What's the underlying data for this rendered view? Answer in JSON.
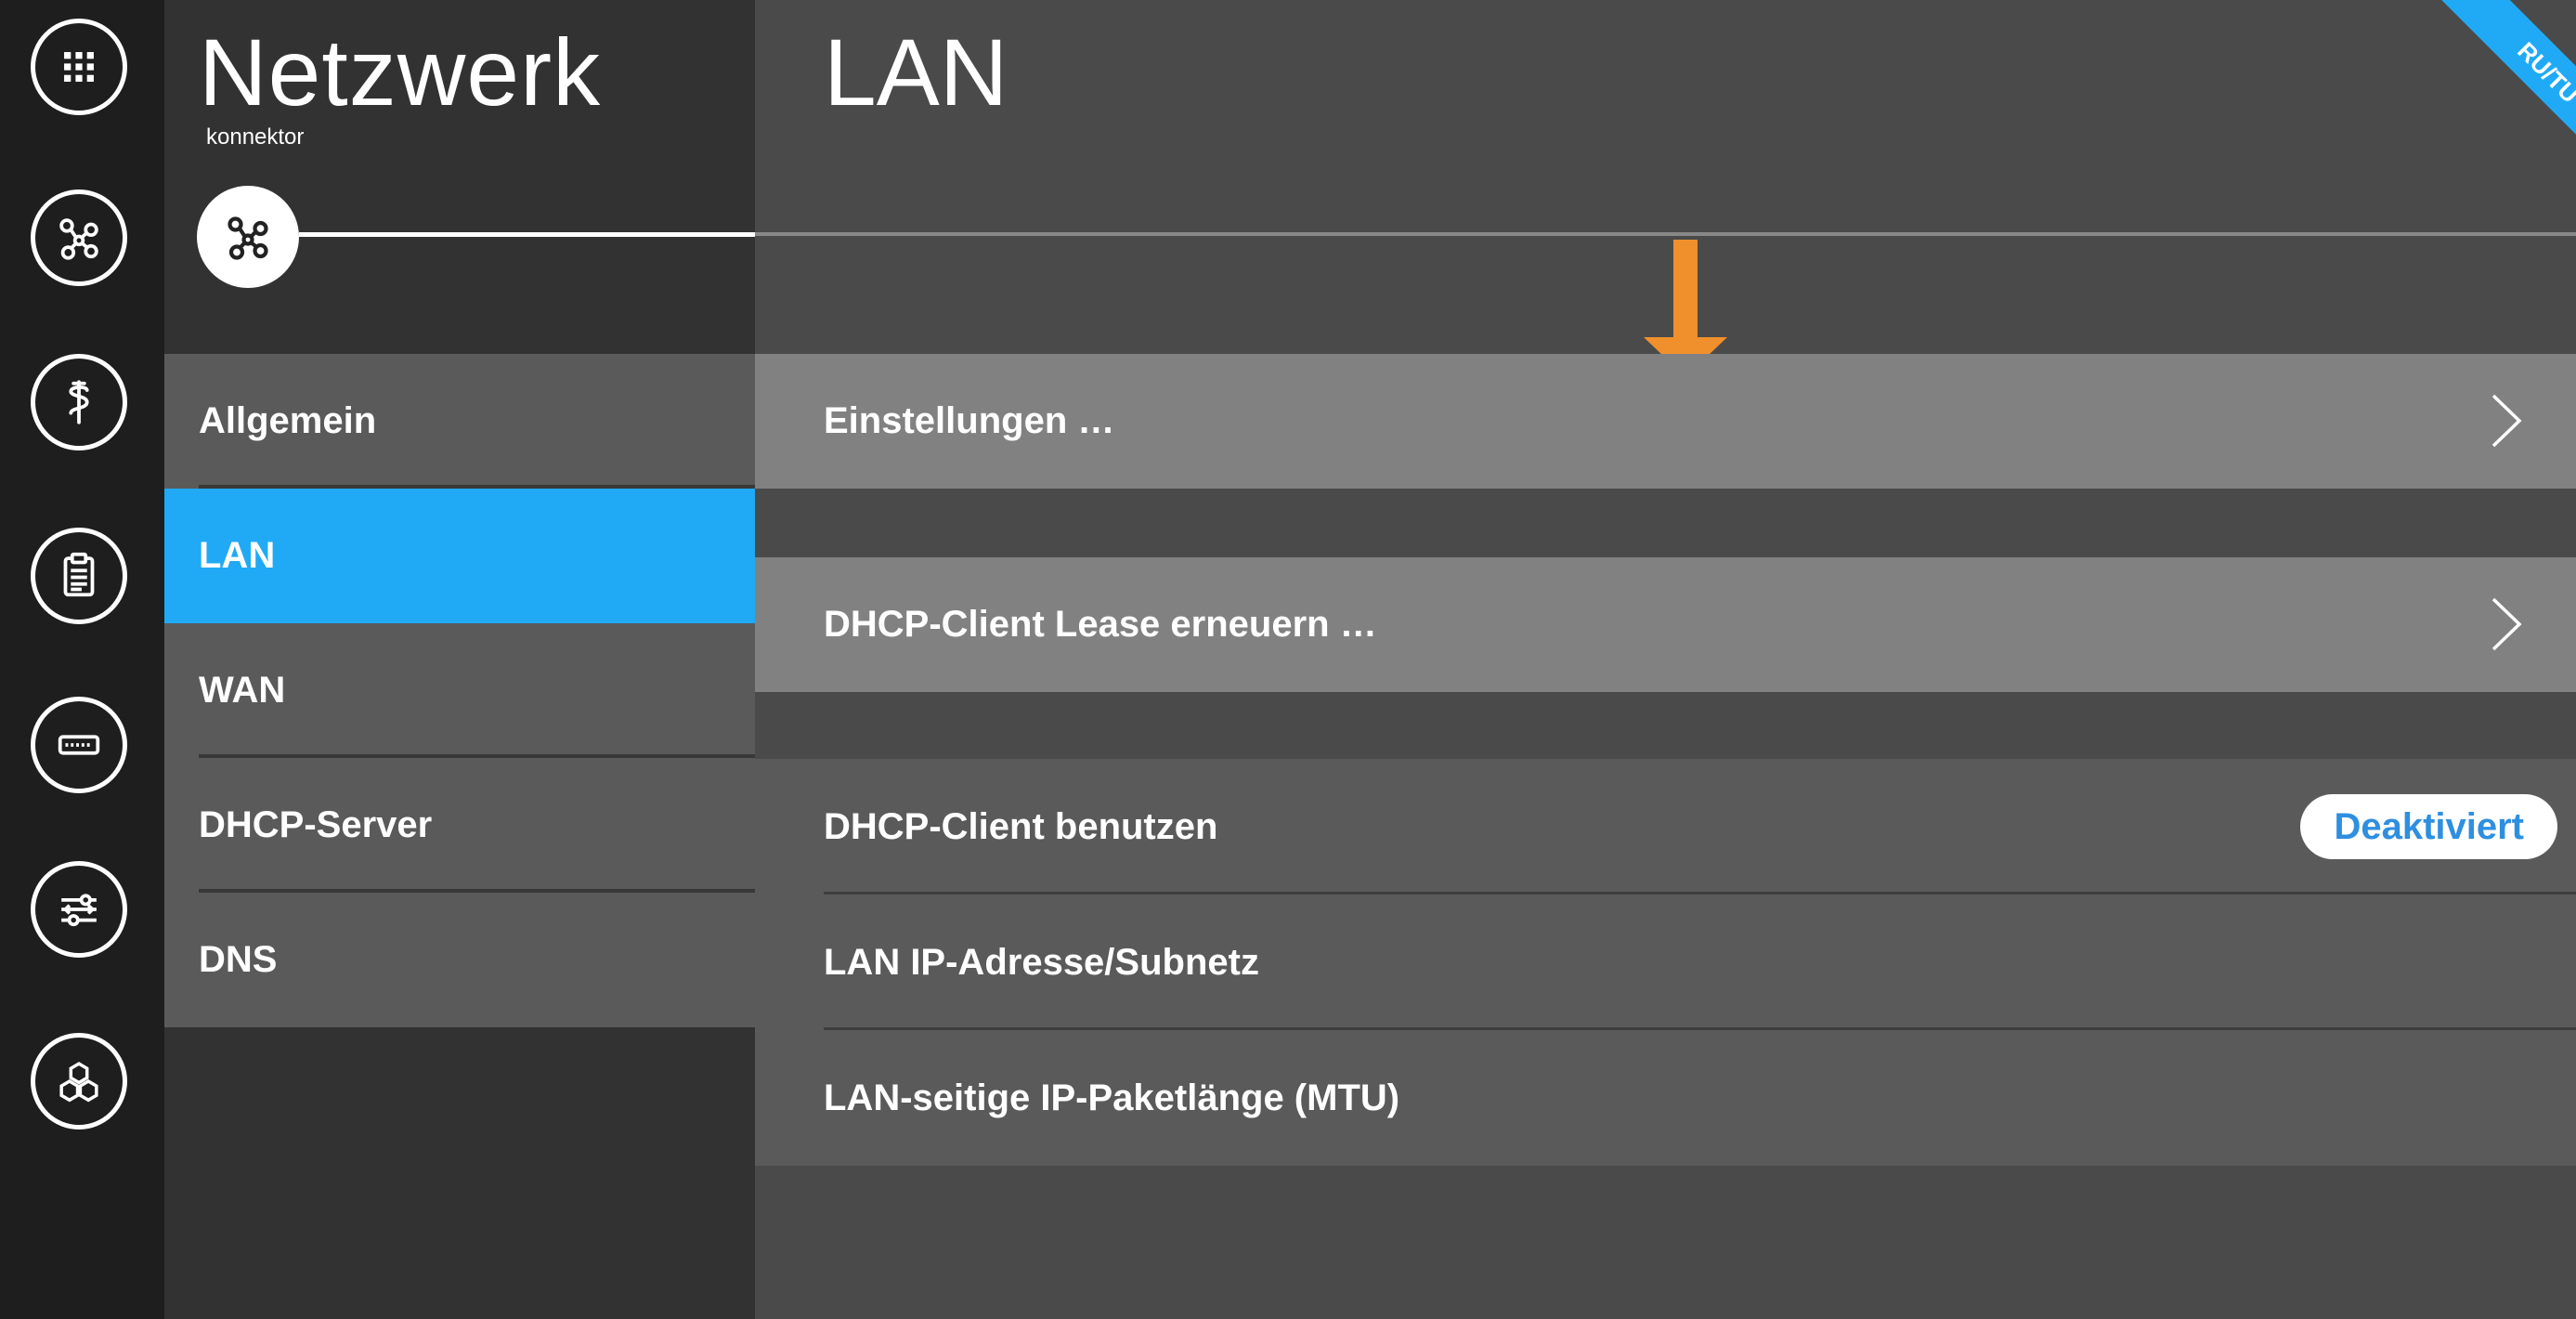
{
  "rail": {
    "icons": [
      "apps-grid-icon",
      "network-icon",
      "health-icon",
      "clipboard-icon",
      "device-port-icon",
      "settings-sliders-icon",
      "hexagons-icon"
    ]
  },
  "sidebar": {
    "title": "Netzwerk",
    "subtitle": "konnektor",
    "items": [
      {
        "label": "Allgemein",
        "active": false
      },
      {
        "label": "LAN",
        "active": true
      },
      {
        "label": "WAN",
        "active": false
      },
      {
        "label": "DHCP-Server",
        "active": false
      },
      {
        "label": "DNS",
        "active": false
      }
    ]
  },
  "main": {
    "title": "LAN",
    "ribbon": "RU/TU",
    "actions": [
      {
        "label": "Einstellungen …"
      },
      {
        "label": "DHCP-Client Lease erneuern …"
      }
    ],
    "properties": [
      {
        "label": "DHCP-Client benutzen",
        "value": "Deaktiviert"
      },
      {
        "label": "LAN IP-Adresse/Subnetz"
      },
      {
        "label": "LAN-seitige IP-Paketlänge (MTU)"
      }
    ]
  },
  "colors": {
    "accent": "#20aaf5",
    "annotation_arrow": "#f0902c",
    "toggle_text": "#2e8fe0"
  }
}
